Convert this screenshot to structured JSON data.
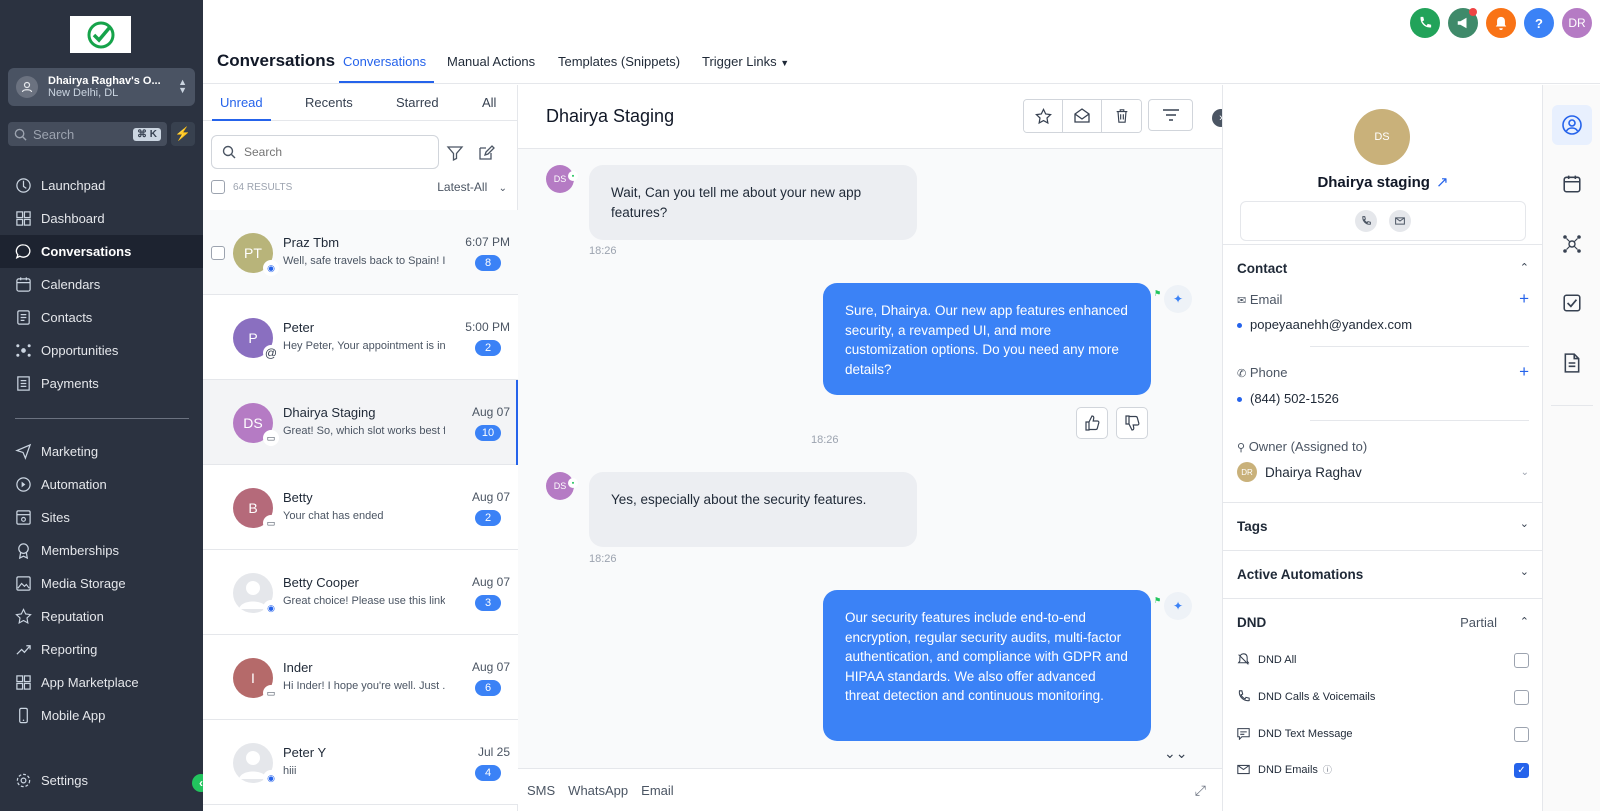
{
  "sidebar": {
    "account": {
      "name": "Dhairya Raghav's O...",
      "location": "New Delhi, DL"
    },
    "search": {
      "placeholder": "Search",
      "shortcut": "⌘ K"
    },
    "items": [
      {
        "label": "Launchpad",
        "icon": "rocket-icon"
      },
      {
        "label": "Dashboard",
        "icon": "grid-icon"
      },
      {
        "label": "Conversations",
        "icon": "chat-icon",
        "active": true
      },
      {
        "label": "Calendars",
        "icon": "calendar-icon"
      },
      {
        "label": "Contacts",
        "icon": "contacts-icon"
      },
      {
        "label": "Opportunities",
        "icon": "opportunities-icon"
      },
      {
        "label": "Payments",
        "icon": "payments-icon"
      }
    ],
    "items2": [
      {
        "label": "Marketing",
        "icon": "send-icon"
      },
      {
        "label": "Automation",
        "icon": "automation-icon"
      },
      {
        "label": "Sites",
        "icon": "sites-icon"
      },
      {
        "label": "Memberships",
        "icon": "memberships-icon"
      },
      {
        "label": "Media Storage",
        "icon": "image-icon"
      },
      {
        "label": "Reputation",
        "icon": "star-icon"
      },
      {
        "label": "Reporting",
        "icon": "trend-icon"
      },
      {
        "label": "App Marketplace",
        "icon": "apps-icon"
      },
      {
        "label": "Mobile App",
        "icon": "mobile-icon"
      }
    ],
    "settings": "Settings"
  },
  "topbar": {
    "avatar_initials": "DR",
    "help": "?"
  },
  "header": {
    "title": "Conversations",
    "tabs": [
      "Conversations",
      "Manual Actions",
      "Templates (Snippets)",
      "Trigger Links"
    ]
  },
  "list": {
    "tabs": [
      "Unread",
      "Recents",
      "Starred",
      "All"
    ],
    "search_placeholder": "Search",
    "results": "64 RESULTS",
    "sort": "Latest-All",
    "rows": [
      {
        "initials": "PT",
        "name": "Praz Tbm",
        "preview": "Well, safe travels back to Spain! Is",
        "time": "6:07 PM",
        "count": "8",
        "color": "#b8b47a",
        "channel": "messenger-icon"
      },
      {
        "initials": "P",
        "name": "Peter",
        "preview": "Hey Peter, Your appointment is in :",
        "time": "5:00 PM",
        "count": "2",
        "color": "#8a6fc0",
        "channel": "email-at-icon"
      },
      {
        "initials": "DS",
        "name": "Dhairya Staging",
        "preview": "Great! So, which slot works best fo",
        "time": "Aug 07",
        "count": "10",
        "color": "#b57bc4",
        "channel": "sms-icon"
      },
      {
        "initials": "B",
        "name": "Betty",
        "preview": "Your chat has ended",
        "time": "Aug 07",
        "count": "2",
        "color": "#b56a7a",
        "channel": "live-chat-icon"
      },
      {
        "initials": "",
        "name": "Betty Cooper",
        "preview": "Great choice! Please use this link t",
        "time": "Aug 07",
        "count": "3",
        "color": "#e5e7eb",
        "channel": "messenger-icon"
      },
      {
        "initials": "I",
        "name": "Inder",
        "preview": "Hi Inder! I hope you're well. Just ...",
        "time": "Aug 07",
        "count": "6",
        "color": "#b56a6a",
        "channel": "sms-icon"
      },
      {
        "initials": "",
        "name": "Peter Y",
        "preview": "hiii",
        "time": "Jul 25",
        "count": "4",
        "color": "#e5e7eb",
        "channel": "messenger-icon"
      }
    ]
  },
  "chat": {
    "title": "Dhairya Staging",
    "avatar_initials": "DS",
    "messages": [
      {
        "dir": "in",
        "text": "Wait, Can you tell me about your new app features?",
        "time": "18:26"
      },
      {
        "dir": "out",
        "text": "Sure, Dhairya. Our new app features enhanced security, a revamped UI, and more customization options. Do you need any more details?",
        "time": "18:26"
      },
      {
        "dir": "in",
        "text": "Yes, especially about the security features.",
        "time": "18:26"
      },
      {
        "dir": "out",
        "text": "Our security features include end-to-end encryption, regular security audits, multi-factor authentication, and compliance with GDPR and HIPAA standards. We also offer advanced threat detection and continuous monitoring."
      }
    ],
    "footer_tabs": [
      "SMS",
      "WhatsApp",
      "Email"
    ]
  },
  "contact": {
    "initials": "DS",
    "name": "Dhairya staging",
    "section_contact": "Contact",
    "email_label": "Email",
    "email": "popeyaanehh@yandex.com",
    "phone_label": "Phone",
    "phone": "(844) 502-1526",
    "owner_label": "Owner (Assigned to)",
    "owner_initials": "DR",
    "owner": "Dhairya Raghav",
    "tags": "Tags",
    "automations": "Active Automations",
    "dnd": "DND",
    "dnd_status": "Partial",
    "dnd_items": [
      {
        "label": "DND All",
        "checked": false
      },
      {
        "label": "DND Calls & Voicemails",
        "checked": false
      },
      {
        "label": "DND Text Message",
        "checked": false
      },
      {
        "label": "DND Emails",
        "checked": true
      }
    ]
  },
  "colors": {
    "accent": "#2563eb",
    "sidebar": "#2b3240",
    "outgoing": "#3b82f6"
  }
}
